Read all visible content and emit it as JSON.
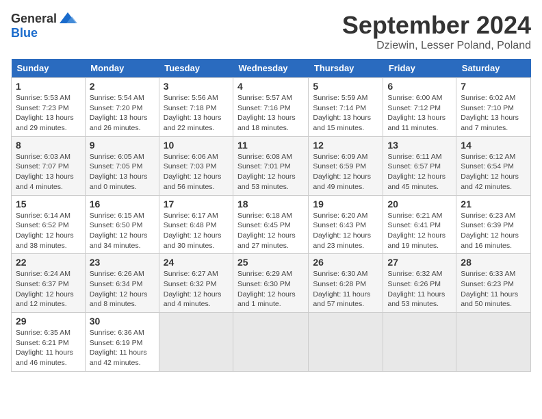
{
  "header": {
    "logo_general": "General",
    "logo_blue": "Blue",
    "month_title": "September 2024",
    "location": "Dziewin, Lesser Poland, Poland"
  },
  "weekdays": [
    "Sunday",
    "Monday",
    "Tuesday",
    "Wednesday",
    "Thursday",
    "Friday",
    "Saturday"
  ],
  "weeks": [
    [
      {
        "day": "1",
        "info": "Sunrise: 5:53 AM\nSunset: 7:23 PM\nDaylight: 13 hours\nand 29 minutes."
      },
      {
        "day": "2",
        "info": "Sunrise: 5:54 AM\nSunset: 7:20 PM\nDaylight: 13 hours\nand 26 minutes."
      },
      {
        "day": "3",
        "info": "Sunrise: 5:56 AM\nSunset: 7:18 PM\nDaylight: 13 hours\nand 22 minutes."
      },
      {
        "day": "4",
        "info": "Sunrise: 5:57 AM\nSunset: 7:16 PM\nDaylight: 13 hours\nand 18 minutes."
      },
      {
        "day": "5",
        "info": "Sunrise: 5:59 AM\nSunset: 7:14 PM\nDaylight: 13 hours\nand 15 minutes."
      },
      {
        "day": "6",
        "info": "Sunrise: 6:00 AM\nSunset: 7:12 PM\nDaylight: 13 hours\nand 11 minutes."
      },
      {
        "day": "7",
        "info": "Sunrise: 6:02 AM\nSunset: 7:10 PM\nDaylight: 13 hours\nand 7 minutes."
      }
    ],
    [
      {
        "day": "8",
        "info": "Sunrise: 6:03 AM\nSunset: 7:07 PM\nDaylight: 13 hours\nand 4 minutes."
      },
      {
        "day": "9",
        "info": "Sunrise: 6:05 AM\nSunset: 7:05 PM\nDaylight: 13 hours\nand 0 minutes."
      },
      {
        "day": "10",
        "info": "Sunrise: 6:06 AM\nSunset: 7:03 PM\nDaylight: 12 hours\nand 56 minutes."
      },
      {
        "day": "11",
        "info": "Sunrise: 6:08 AM\nSunset: 7:01 PM\nDaylight: 12 hours\nand 53 minutes."
      },
      {
        "day": "12",
        "info": "Sunrise: 6:09 AM\nSunset: 6:59 PM\nDaylight: 12 hours\nand 49 minutes."
      },
      {
        "day": "13",
        "info": "Sunrise: 6:11 AM\nSunset: 6:57 PM\nDaylight: 12 hours\nand 45 minutes."
      },
      {
        "day": "14",
        "info": "Sunrise: 6:12 AM\nSunset: 6:54 PM\nDaylight: 12 hours\nand 42 minutes."
      }
    ],
    [
      {
        "day": "15",
        "info": "Sunrise: 6:14 AM\nSunset: 6:52 PM\nDaylight: 12 hours\nand 38 minutes."
      },
      {
        "day": "16",
        "info": "Sunrise: 6:15 AM\nSunset: 6:50 PM\nDaylight: 12 hours\nand 34 minutes."
      },
      {
        "day": "17",
        "info": "Sunrise: 6:17 AM\nSunset: 6:48 PM\nDaylight: 12 hours\nand 30 minutes."
      },
      {
        "day": "18",
        "info": "Sunrise: 6:18 AM\nSunset: 6:45 PM\nDaylight: 12 hours\nand 27 minutes."
      },
      {
        "day": "19",
        "info": "Sunrise: 6:20 AM\nSunset: 6:43 PM\nDaylight: 12 hours\nand 23 minutes."
      },
      {
        "day": "20",
        "info": "Sunrise: 6:21 AM\nSunset: 6:41 PM\nDaylight: 12 hours\nand 19 minutes."
      },
      {
        "day": "21",
        "info": "Sunrise: 6:23 AM\nSunset: 6:39 PM\nDaylight: 12 hours\nand 16 minutes."
      }
    ],
    [
      {
        "day": "22",
        "info": "Sunrise: 6:24 AM\nSunset: 6:37 PM\nDaylight: 12 hours\nand 12 minutes."
      },
      {
        "day": "23",
        "info": "Sunrise: 6:26 AM\nSunset: 6:34 PM\nDaylight: 12 hours\nand 8 minutes."
      },
      {
        "day": "24",
        "info": "Sunrise: 6:27 AM\nSunset: 6:32 PM\nDaylight: 12 hours\nand 4 minutes."
      },
      {
        "day": "25",
        "info": "Sunrise: 6:29 AM\nSunset: 6:30 PM\nDaylight: 12 hours\nand 1 minute."
      },
      {
        "day": "26",
        "info": "Sunrise: 6:30 AM\nSunset: 6:28 PM\nDaylight: 11 hours\nand 57 minutes."
      },
      {
        "day": "27",
        "info": "Sunrise: 6:32 AM\nSunset: 6:26 PM\nDaylight: 11 hours\nand 53 minutes."
      },
      {
        "day": "28",
        "info": "Sunrise: 6:33 AM\nSunset: 6:23 PM\nDaylight: 11 hours\nand 50 minutes."
      }
    ],
    [
      {
        "day": "29",
        "info": "Sunrise: 6:35 AM\nSunset: 6:21 PM\nDaylight: 11 hours\nand 46 minutes."
      },
      {
        "day": "30",
        "info": "Sunrise: 6:36 AM\nSunset: 6:19 PM\nDaylight: 11 hours\nand 42 minutes."
      },
      {
        "day": "",
        "info": ""
      },
      {
        "day": "",
        "info": ""
      },
      {
        "day": "",
        "info": ""
      },
      {
        "day": "",
        "info": ""
      },
      {
        "day": "",
        "info": ""
      }
    ]
  ]
}
